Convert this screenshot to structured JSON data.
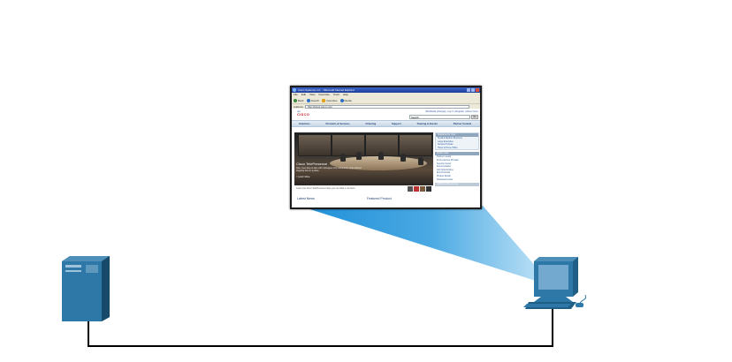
{
  "colors": {
    "beam_dark": "#1f8fd8",
    "beam_light": "#a9d7f3",
    "device_blue": "#2f6f95",
    "link_line": "#000000"
  },
  "browser": {
    "window_title": "Cisco Systems, Inc. - Microsoft Internet Explorer",
    "menu": [
      "File",
      "Edit",
      "View",
      "Favorites",
      "Tools",
      "Help"
    ],
    "toolbar": [
      "Back",
      "Search",
      "Favorites",
      "Media"
    ],
    "address_label": "Address",
    "address_value": "http://www.cisco.com",
    "logo_text": "CISCO",
    "top_links": "Worldwide [change]  |  Log In  |  Register  |  About Cisco",
    "search_placeholder": "Search",
    "search_go": "Go",
    "nav": [
      "Solutions",
      "Products & Services",
      "Ordering",
      "Support",
      "Training & Events",
      "Partner Central"
    ],
    "hero_title": "Cisco TelePresence",
    "hero_text": "Now, meet face-to-face with colleagues from around the world without stepping foot on a plane.",
    "hero_more": "> Learn More",
    "strip_text": "Learn how Cisco TelePresence helps you use what is not there",
    "latest_news": "Latest News",
    "featured_product": "Featured Product",
    "side_header": "Solutions for Your",
    "side_links": [
      "Small & Medium Business",
      "Large Enterprise",
      "Service Provider",
      "Home & Home Office"
    ],
    "side_header2": "Quick Links",
    "side_links2": [
      "Partner Locator",
      "Find a Service Provider",
      "Security Center",
      "Documentation",
      "Job Opportunities",
      "IR & Financial",
      "Product Recall",
      "Download Center"
    ],
    "side_header3": "Additional Resources"
  }
}
